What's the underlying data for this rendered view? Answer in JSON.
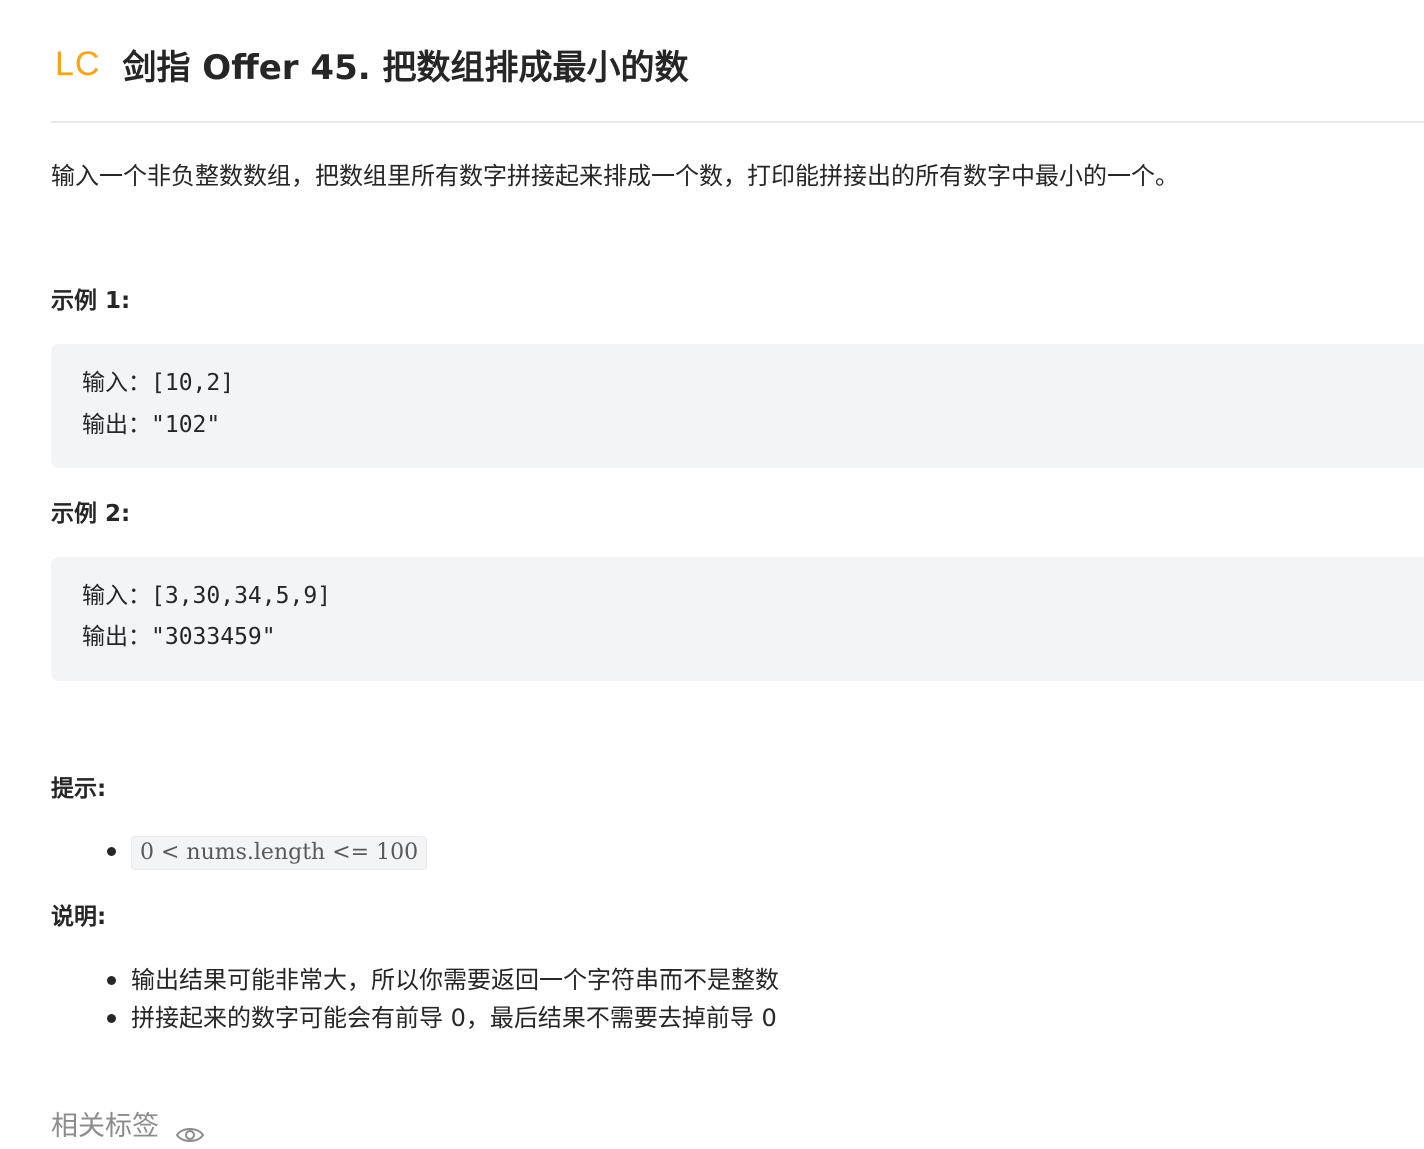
{
  "header": {
    "logo_text": "LC",
    "title": "剑指 Offer 45. 把数组排成最小的数"
  },
  "description": "输入一个非负整数数组，把数组里所有数字拼接起来排成一个数，打印能拼接出的所有数字中最小的一个。",
  "examples": [
    {
      "label": "示例 1:",
      "input_label": "输入：",
      "input_value": "[10,2]",
      "output_label": "输出：",
      "output_value": "\"102\""
    },
    {
      "label": "示例 2:",
      "input_label": "输入：",
      "input_value": "[3,30,34,5,9]",
      "output_label": "输出：",
      "output_value": "\"3033459\""
    }
  ],
  "hints": {
    "label": "提示:",
    "items": [
      "0 < nums.length <= 100"
    ]
  },
  "notes": {
    "label": "说明:",
    "items": [
      "输出结果可能非常大，所以你需要返回一个字符串而不是整数",
      "拼接起来的数字可能会有前导 0，最后结果不需要去掉前导 0"
    ]
  },
  "tags": {
    "label": "相关标签",
    "icon": "eye-icon"
  },
  "colors": {
    "brand": "#ffa116",
    "code_bg": "#f3f4f6",
    "muted": "#8c8c8c"
  }
}
